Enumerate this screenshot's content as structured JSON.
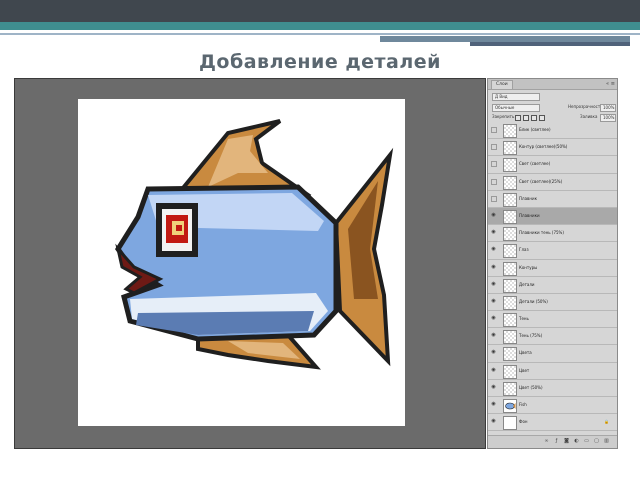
{
  "slide": {
    "title": "Добавление деталей"
  },
  "panel": {
    "tab_label": "Слои",
    "collapse_glyph": "«",
    "menu_glyph": "≡",
    "kind_value": "Д Вид",
    "blend_mode_value": "Обычные",
    "opacity_label": "Непрозрачность",
    "opacity_value": "100%",
    "lock_label": "Закрепить",
    "fill_label": "Заливка",
    "fill_value": "100%",
    "layers": [
      {
        "name": "Блик (светлее)",
        "visible": false,
        "thumb": "transparent",
        "selected": false
      },
      {
        "name": "Контур (светлее)(50%)",
        "visible": false,
        "thumb": "transparent",
        "selected": false
      },
      {
        "name": "Свет (светлее)",
        "visible": false,
        "thumb": "transparent",
        "selected": false
      },
      {
        "name": "Свет (светлее)(25%)",
        "visible": false,
        "thumb": "transparent",
        "selected": false
      },
      {
        "name": "Плавник",
        "visible": false,
        "thumb": "transparent",
        "selected": false
      },
      {
        "name": "Плавники",
        "visible": true,
        "thumb": "transparent",
        "selected": true
      },
      {
        "name": "Плавники тень (75%)",
        "visible": true,
        "thumb": "transparent",
        "selected": false
      },
      {
        "name": "Глаз",
        "visible": true,
        "thumb": "transparent",
        "selected": false
      },
      {
        "name": "Контуры",
        "visible": true,
        "thumb": "transparent",
        "selected": false
      },
      {
        "name": "Детали",
        "visible": true,
        "thumb": "transparent",
        "selected": false
      },
      {
        "name": "Детали (50%)",
        "visible": true,
        "thumb": "transparent",
        "selected": false
      },
      {
        "name": "Тень",
        "visible": true,
        "thumb": "transparent",
        "selected": false
      },
      {
        "name": "Тень (75%)",
        "visible": true,
        "thumb": "transparent",
        "selected": false
      },
      {
        "name": "Цвета",
        "visible": true,
        "thumb": "transparent",
        "selected": false
      },
      {
        "name": "Цвет",
        "visible": true,
        "thumb": "transparent",
        "selected": false
      },
      {
        "name": "Цвет (50%)",
        "visible": true,
        "thumb": "transparent",
        "selected": false
      },
      {
        "name": "Fish",
        "visible": true,
        "thumb": "fish",
        "selected": false
      },
      {
        "name": "Фон",
        "visible": true,
        "thumb": "plain",
        "selected": false,
        "locked": true
      }
    ],
    "footer_buttons": [
      "link-icon",
      "fx-icon",
      "mask-icon",
      "adjustment-icon",
      "folder-icon",
      "new-layer-icon",
      "trash-icon"
    ]
  },
  "colors": {
    "body_blue": "#7ea7e0",
    "body_light": "#c2d6f5",
    "belly": "#e6eef8",
    "shadow_blue": "#5b7cb3",
    "fin_orange": "#c98a3f",
    "fin_light": "#e2b57c",
    "fin_dark": "#8a5420",
    "eye_red": "#c21a12",
    "mouth": "#6e1a15",
    "outline": "#1f1f1f"
  }
}
